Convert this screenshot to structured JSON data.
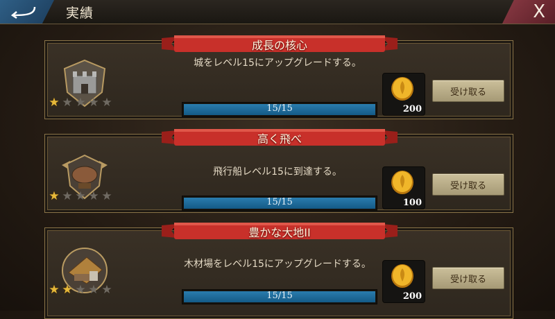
{
  "header": {
    "title": "実績",
    "close_label": "X"
  },
  "achievements": [
    {
      "name": "成長の核心",
      "description": "城をレベル15にアップグレードする。",
      "progress_text": "15/15",
      "progress_fraction": 1.0,
      "reward_amount": "200",
      "reward_icon": "gold-coin-icon",
      "claim_label": "受け取る",
      "stars_earned": 1,
      "stars_total": 5,
      "badge_icon": "castle-badge-icon"
    },
    {
      "name": "高く飛べ",
      "description": "飛行船レベル15に到達する。",
      "progress_text": "15/15",
      "progress_fraction": 1.0,
      "reward_amount": "100",
      "reward_icon": "gold-coin-icon",
      "claim_label": "受け取る",
      "stars_earned": 1,
      "stars_total": 5,
      "badge_icon": "airship-badge-icon"
    },
    {
      "name": "豊かな大地II",
      "description": "木材場をレベル15にアップグレードする。",
      "progress_text": "15/15",
      "progress_fraction": 1.0,
      "reward_amount": "200",
      "reward_icon": "gold-coin-icon",
      "claim_label": "受け取る",
      "stars_earned": 2,
      "stars_total": 5,
      "badge_icon": "lumber-yard-badge-icon"
    }
  ],
  "colors": {
    "ribbon": "#c8302a",
    "progress": "#1e6fa0",
    "star_on": "#e7b93a",
    "coin": "#e6a91c"
  }
}
